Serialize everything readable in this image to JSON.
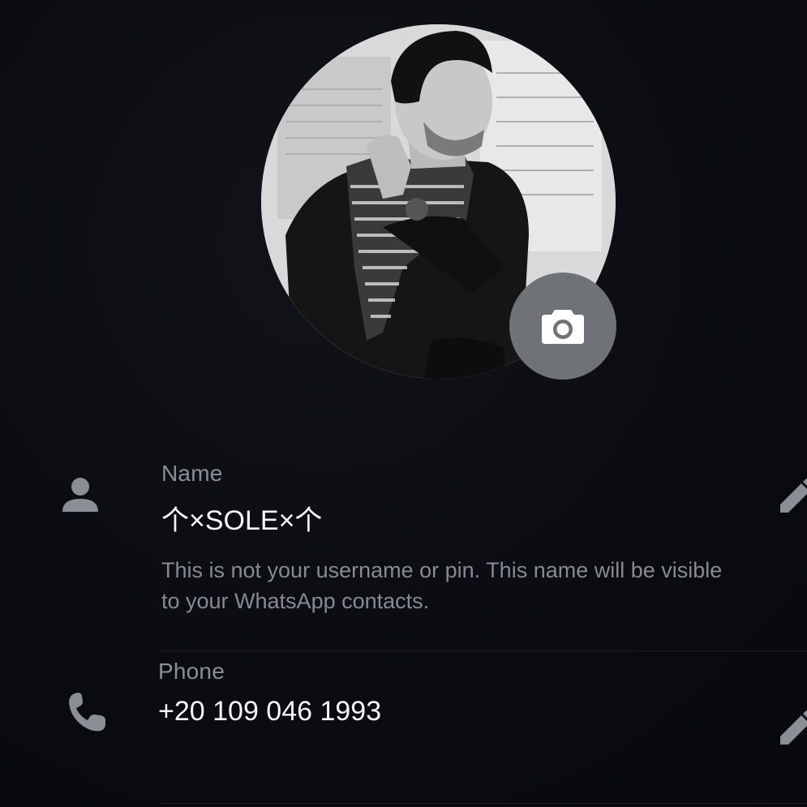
{
  "profile": {
    "avatar_alt": "Profile photo",
    "change_photo": "camera-icon"
  },
  "name": {
    "label": "Name",
    "value": "个×SOLE×个",
    "hint_line1": "This is not your username or pin. This name will be visible",
    "hint_line2": "to your WhatsApp contacts.",
    "icon": "person-icon",
    "edit_icon": "pencil-icon"
  },
  "phone": {
    "label": "Phone",
    "value": "+20 109 046 1993",
    "icon": "phone-icon",
    "edit_icon": "pencil-icon"
  },
  "colors": {
    "background": "#0b0c10",
    "icon": "#8a8f96",
    "camera_button": "#6f7378",
    "text_primary": "#f4f5f6",
    "text_secondary": "#8a8f96"
  }
}
